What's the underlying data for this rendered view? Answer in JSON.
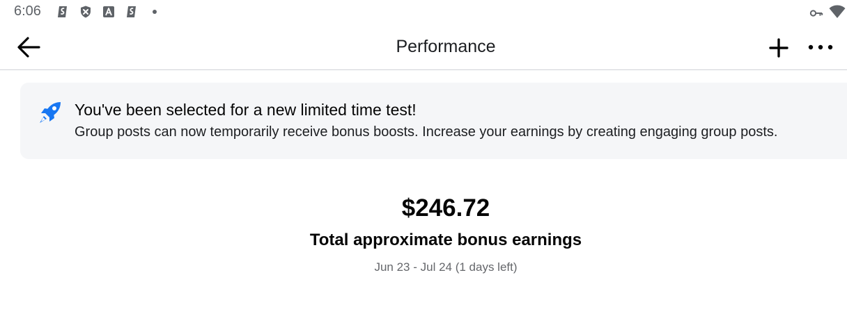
{
  "status_bar": {
    "time": "6:06",
    "icons": [
      "vpn-app-icon",
      "shield-x-icon",
      "font-a-icon",
      "vpn-app-icon",
      "notification-dot"
    ],
    "right_icons": [
      "key-icon",
      "wifi-icon"
    ]
  },
  "header": {
    "title": "Performance",
    "back_icon": "arrow-left-icon",
    "add_icon": "plus-icon",
    "more_icon": "more-horizontal-icon"
  },
  "banner": {
    "icon": "rocket-icon",
    "title": "You've been selected for a new limited time test!",
    "text": "Group posts can now temporarily receive bonus boosts. Increase your earnings by creating engaging group posts."
  },
  "earnings": {
    "amount": "$246.72",
    "label": "Total approximate bonus earnings",
    "date_range": "Jun 23 - Jul 24 (1 days left)"
  },
  "colors": {
    "accent_blue": "#1877f2",
    "banner_bg": "#f5f6f8",
    "divider": "#cfd2d6",
    "muted_text": "#65676b"
  }
}
